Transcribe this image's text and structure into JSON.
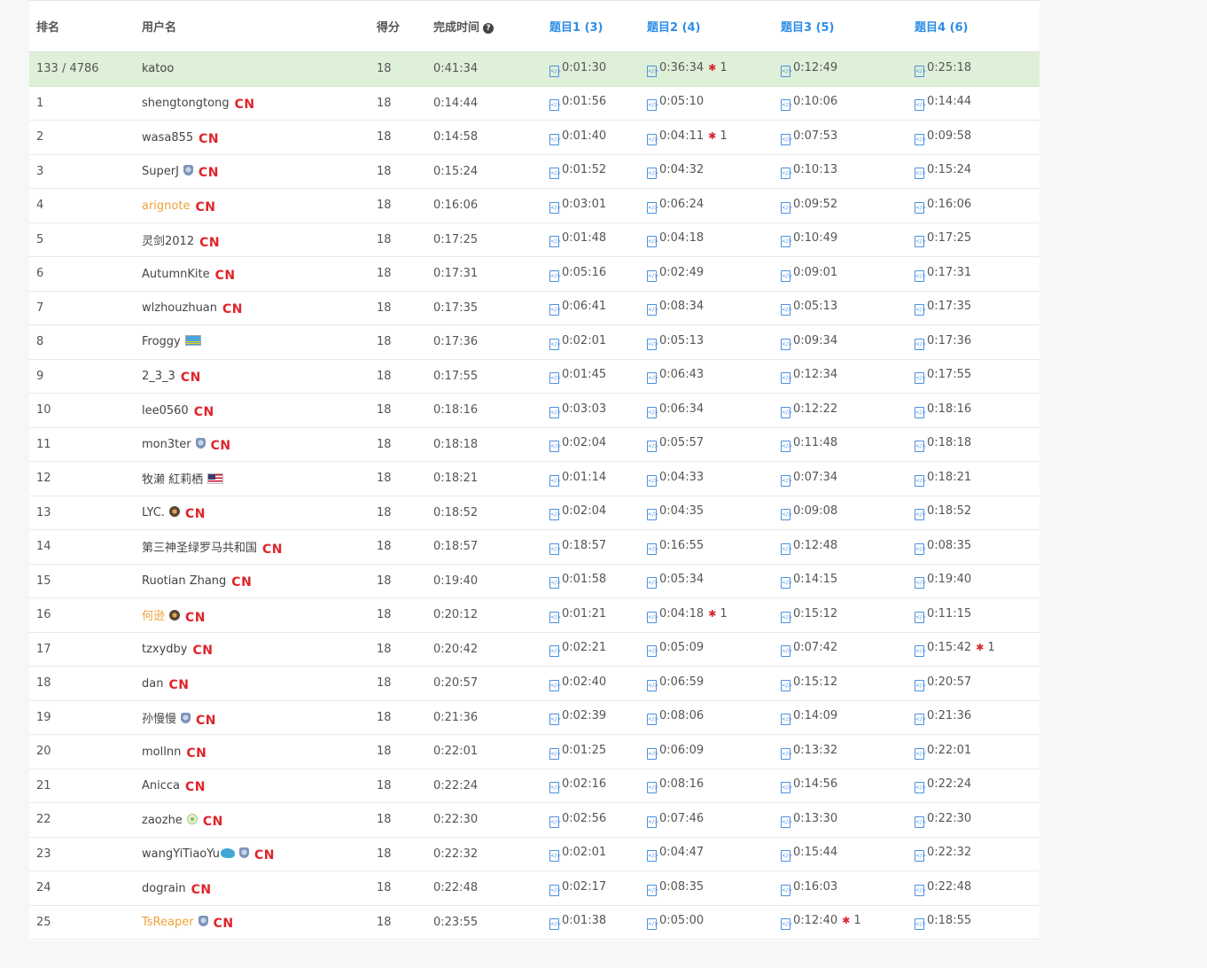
{
  "headers": {
    "rank": "排名",
    "username": "用户名",
    "score": "得分",
    "finish_time": "完成时间",
    "q1": "题目1 (3)",
    "q2": "题目2 (4)",
    "q3": "题目3 (5)",
    "q4": "题目4 (6)"
  },
  "help_glyph": "?",
  "code_icon_glyph": "</>",
  "bug_glyph": "✱",
  "colors": {
    "accent": "#2e8ee6",
    "highlight_row": "#dff0d8",
    "country": "#e0242a",
    "orange_user": "#f0a23a",
    "bug": "#d9262f"
  },
  "rows": [
    {
      "rank": "133 / 4786",
      "user": "katoo",
      "badge": "",
      "country": "",
      "score": "18",
      "time": "0:41:34",
      "q": [
        {
          "t": "0:01:30"
        },
        {
          "t": "0:36:34",
          "bugs": "1"
        },
        {
          "t": "0:12:49"
        },
        {
          "t": "0:25:18"
        }
      ],
      "me": true
    },
    {
      "rank": "1",
      "user": "shengtongtong",
      "badge": "",
      "country": "CN",
      "score": "18",
      "time": "0:14:44",
      "q": [
        {
          "t": "0:01:56"
        },
        {
          "t": "0:05:10"
        },
        {
          "t": "0:10:06"
        },
        {
          "t": "0:14:44"
        }
      ]
    },
    {
      "rank": "2",
      "user": "wasa855",
      "badge": "",
      "country": "CN",
      "score": "18",
      "time": "0:14:58",
      "q": [
        {
          "t": "0:01:40"
        },
        {
          "t": "0:04:11",
          "bugs": "1"
        },
        {
          "t": "0:07:53"
        },
        {
          "t": "0:09:58"
        }
      ]
    },
    {
      "rank": "3",
      "user": "SuperJ",
      "badge": "shield",
      "country": "CN",
      "score": "18",
      "time": "0:15:24",
      "q": [
        {
          "t": "0:01:52"
        },
        {
          "t": "0:04:32"
        },
        {
          "t": "0:10:13"
        },
        {
          "t": "0:15:24"
        }
      ]
    },
    {
      "rank": "4",
      "user": "arignote",
      "badge": "",
      "country": "CN",
      "score": "18",
      "time": "0:16:06",
      "q": [
        {
          "t": "0:03:01"
        },
        {
          "t": "0:06:24"
        },
        {
          "t": "0:09:52"
        },
        {
          "t": "0:16:06"
        }
      ],
      "orange": true
    },
    {
      "rank": "5",
      "user": "灵剑2012",
      "badge": "",
      "country": "CN",
      "score": "18",
      "time": "0:17:25",
      "q": [
        {
          "t": "0:01:48"
        },
        {
          "t": "0:04:18"
        },
        {
          "t": "0:10:49"
        },
        {
          "t": "0:17:25"
        }
      ]
    },
    {
      "rank": "6",
      "user": "AutumnKite",
      "badge": "",
      "country": "CN",
      "score": "18",
      "time": "0:17:31",
      "q": [
        {
          "t": "0:05:16"
        },
        {
          "t": "0:02:49"
        },
        {
          "t": "0:09:01"
        },
        {
          "t": "0:17:31"
        }
      ]
    },
    {
      "rank": "7",
      "user": "wlzhouzhuan",
      "badge": "",
      "country": "CN",
      "score": "18",
      "time": "0:17:35",
      "q": [
        {
          "t": "0:06:41"
        },
        {
          "t": "0:08:34"
        },
        {
          "t": "0:05:13"
        },
        {
          "t": "0:17:35"
        }
      ]
    },
    {
      "rank": "8",
      "user": "Froggy",
      "badge": "flag-aw",
      "country": "",
      "score": "18",
      "time": "0:17:36",
      "q": [
        {
          "t": "0:02:01"
        },
        {
          "t": "0:05:13"
        },
        {
          "t": "0:09:34"
        },
        {
          "t": "0:17:36"
        }
      ]
    },
    {
      "rank": "9",
      "user": "2_3_3",
      "badge": "",
      "country": "CN",
      "score": "18",
      "time": "0:17:55",
      "q": [
        {
          "t": "0:01:45"
        },
        {
          "t": "0:06:43"
        },
        {
          "t": "0:12:34"
        },
        {
          "t": "0:17:55"
        }
      ]
    },
    {
      "rank": "10",
      "user": "lee0560",
      "badge": "",
      "country": "CN",
      "score": "18",
      "time": "0:18:16",
      "q": [
        {
          "t": "0:03:03"
        },
        {
          "t": "0:06:34"
        },
        {
          "t": "0:12:22"
        },
        {
          "t": "0:18:16"
        }
      ]
    },
    {
      "rank": "11",
      "user": "mon3ter",
      "badge": "shield",
      "country": "CN",
      "score": "18",
      "time": "0:18:18",
      "q": [
        {
          "t": "0:02:04"
        },
        {
          "t": "0:05:57"
        },
        {
          "t": "0:11:48"
        },
        {
          "t": "0:18:18"
        }
      ]
    },
    {
      "rank": "12",
      "user": "牧濑 紅莉栖",
      "badge": "flag-us",
      "country": "",
      "score": "18",
      "time": "0:18:21",
      "q": [
        {
          "t": "0:01:14"
        },
        {
          "t": "0:04:33"
        },
        {
          "t": "0:07:34"
        },
        {
          "t": "0:18:21"
        }
      ]
    },
    {
      "rank": "13",
      "user": "LYC.",
      "badge": "hex",
      "country": "CN",
      "score": "18",
      "time": "0:18:52",
      "q": [
        {
          "t": "0:02:04"
        },
        {
          "t": "0:04:35"
        },
        {
          "t": "0:09:08"
        },
        {
          "t": "0:18:52"
        }
      ]
    },
    {
      "rank": "14",
      "user": "第三神圣绿罗马共和国",
      "badge": "",
      "country": "CN",
      "score": "18",
      "time": "0:18:57",
      "q": [
        {
          "t": "0:18:57"
        },
        {
          "t": "0:16:55"
        },
        {
          "t": "0:12:48"
        },
        {
          "t": "0:08:35"
        }
      ]
    },
    {
      "rank": "15",
      "user": "Ruotian Zhang",
      "badge": "",
      "country": "CN",
      "score": "18",
      "time": "0:19:40",
      "q": [
        {
          "t": "0:01:58"
        },
        {
          "t": "0:05:34"
        },
        {
          "t": "0:14:15"
        },
        {
          "t": "0:19:40"
        }
      ]
    },
    {
      "rank": "16",
      "user": "何逊",
      "badge": "hex",
      "country": "CN",
      "score": "18",
      "time": "0:20:12",
      "q": [
        {
          "t": "0:01:21"
        },
        {
          "t": "0:04:18",
          "bugs": "1"
        },
        {
          "t": "0:15:12"
        },
        {
          "t": "0:11:15"
        }
      ],
      "orange": true
    },
    {
      "rank": "17",
      "user": "tzxydby",
      "badge": "",
      "country": "CN",
      "score": "18",
      "time": "0:20:42",
      "q": [
        {
          "t": "0:02:21"
        },
        {
          "t": "0:05:09"
        },
        {
          "t": "0:07:42"
        },
        {
          "t": "0:15:42",
          "bugs": "1"
        }
      ]
    },
    {
      "rank": "18",
      "user": "dan",
      "badge": "",
      "country": "CN",
      "score": "18",
      "time": "0:20:57",
      "q": [
        {
          "t": "0:02:40"
        },
        {
          "t": "0:06:59"
        },
        {
          "t": "0:15:12"
        },
        {
          "t": "0:20:57"
        }
      ]
    },
    {
      "rank": "19",
      "user": "孙慢慢",
      "badge": "shield",
      "country": "CN",
      "score": "18",
      "time": "0:21:36",
      "q": [
        {
          "t": "0:02:39"
        },
        {
          "t": "0:08:06"
        },
        {
          "t": "0:14:09"
        },
        {
          "t": "0:21:36"
        }
      ]
    },
    {
      "rank": "20",
      "user": "mollnn",
      "badge": "",
      "country": "CN",
      "score": "18",
      "time": "0:22:01",
      "q": [
        {
          "t": "0:01:25"
        },
        {
          "t": "0:06:09"
        },
        {
          "t": "0:13:32"
        },
        {
          "t": "0:22:01"
        }
      ]
    },
    {
      "rank": "21",
      "user": "Anicca",
      "badge": "",
      "country": "CN",
      "score": "18",
      "time": "0:22:24",
      "q": [
        {
          "t": "0:02:16"
        },
        {
          "t": "0:08:16"
        },
        {
          "t": "0:14:56"
        },
        {
          "t": "0:22:24"
        }
      ]
    },
    {
      "rank": "22",
      "user": "zaozhe",
      "badge": "green",
      "country": "CN",
      "score": "18",
      "time": "0:22:30",
      "q": [
        {
          "t": "0:02:56"
        },
        {
          "t": "0:07:46"
        },
        {
          "t": "0:13:30"
        },
        {
          "t": "0:22:30"
        }
      ]
    },
    {
      "rank": "23",
      "user": "wangYiTiaoYu",
      "badge": "whale-shield",
      "country": "CN",
      "score": "18",
      "time": "0:22:32",
      "q": [
        {
          "t": "0:02:01"
        },
        {
          "t": "0:04:47"
        },
        {
          "t": "0:15:44"
        },
        {
          "t": "0:22:32"
        }
      ]
    },
    {
      "rank": "24",
      "user": "dograin",
      "badge": "",
      "country": "CN",
      "score": "18",
      "time": "0:22:48",
      "q": [
        {
          "t": "0:02:17"
        },
        {
          "t": "0:08:35"
        },
        {
          "t": "0:16:03"
        },
        {
          "t": "0:22:48"
        }
      ]
    },
    {
      "rank": "25",
      "user": "TsReaper",
      "badge": "shield",
      "country": "CN",
      "score": "18",
      "time": "0:23:55",
      "q": [
        {
          "t": "0:01:38"
        },
        {
          "t": "0:05:00"
        },
        {
          "t": "0:12:40",
          "bugs": "1"
        },
        {
          "t": "0:18:55"
        }
      ],
      "orange": true
    }
  ]
}
